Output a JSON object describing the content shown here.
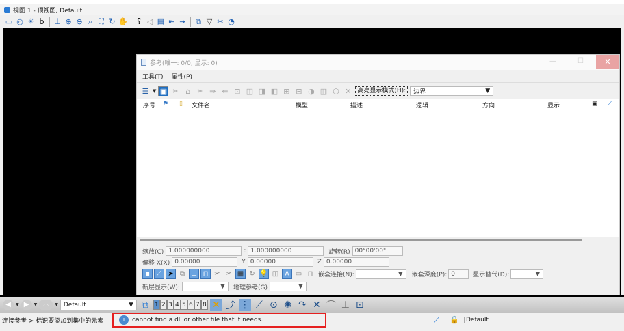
{
  "window": {
    "title": "视图 1 - 顶视图, Default"
  },
  "dialog": {
    "title": "参考(唯一: 0/0, 显示: 0)",
    "menu": [
      "工具(T)",
      "属性(P)"
    ],
    "highlight_label": "高亮显示模式(H):",
    "highlight_value": "边界",
    "columns": [
      "序号",
      "文件名",
      "模型",
      "描述",
      "逻辑",
      "方向",
      "显示"
    ],
    "scale_label": "缩放(C)",
    "scale_1": "1.000000000",
    "scale_sep": ":",
    "scale_2": "1.000000000",
    "rotate_label": "旋转(R)",
    "rotate_value": "00°00'00\"",
    "offset_x_label": "偏移 X(X)",
    "offset_x": "0.00000",
    "y_label": "Y",
    "offset_y": "0.00000",
    "z_label": "Z",
    "offset_z": "0.00000",
    "nest_label": "嵌套连接(N):",
    "nest_depth_label": "嵌套深度(P):",
    "nest_depth": "0",
    "display_override_label": "显示替代(D):",
    "new_level_label": "新层显示(W):",
    "geo_ref_label": "地理参考(G)"
  },
  "bottom_toolbar": {
    "view_set": "Default",
    "views": [
      "1",
      "2",
      "3",
      "4",
      "5",
      "6",
      "7",
      "8"
    ],
    "active_view": "1"
  },
  "status": {
    "prompt": "连接参考 > 标识要添加到集中的元素",
    "message": "cannot find a dll or other file that it needs.",
    "level": "Default"
  },
  "colors": {
    "accent": "#1f6ec0",
    "error_border": "#e52020"
  }
}
